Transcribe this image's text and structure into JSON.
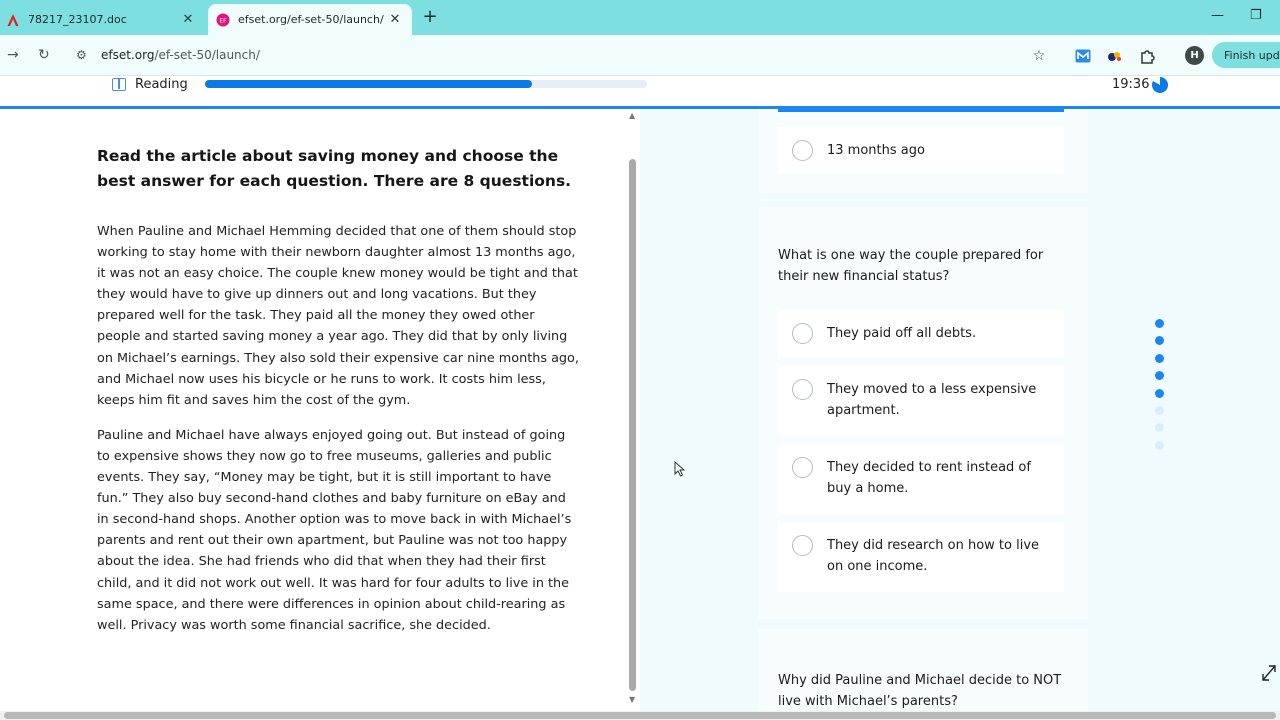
{
  "browser": {
    "tabs": [
      {
        "label": "78217_23107.doc",
        "icon": "acrobat-icon",
        "active": false
      },
      {
        "label": "efset.org/ef-set-50/launch/",
        "icon": "efset-favicon",
        "active": true
      }
    ],
    "url_host": "efset.org",
    "url_path": "/ef-set-50/launch/",
    "profile_initial": "H",
    "update_button": "Finish update",
    "colors": {
      "tabbar": "#7ddfe0",
      "toolbar": "#f1fcfc"
    }
  },
  "test_header": {
    "section": "Reading",
    "progress_fraction": 0.74,
    "timer": "19:36",
    "accent": "#0a7ae6"
  },
  "reading": {
    "instructions": "Read the article about saving money and choose the best answer for each question. There are 8 questions.",
    "paragraphs": [
      "When Pauline and Michael Hemming decided that one of them should stop working to stay home with their newborn daughter almost 13 months ago, it was not an easy choice. The couple knew money would be tight and that they would have to give up dinners out and long vacations. But they prepared well for the task. They paid all the money they owed other people and started saving money a year ago. They did that by only living on Michael’s earnings. They also sold their expensive car nine months ago, and Michael now uses his bicycle or he runs to work. It costs him less, keeps him fit and saves him the cost of the gym.",
      "Pauline and Michael have always enjoyed going out. But instead of going to expensive shows they now go to free museums, galleries and public events. They say, “Money may be tight, but it is still important to have fun.” They also buy second-hand clothes and baby furniture on eBay and in second-hand shops. Another option was to move back in with Michael’s parents and rent out their own apartment, but Pauline was not too happy about the idea. She had friends who did that when they had their first child, and it did not work out well. It was hard for four adults to live in the same space, and there were differences in opinion about child-rearing as well. Privacy was worth some financial sacrifice, she decided."
    ]
  },
  "questions": {
    "previous_option": "13 months ago",
    "current": {
      "question": "What is one way the couple prepared for their new financial status?",
      "options": [
        "They paid off all debts.",
        "They moved to a less expensive apartment.",
        "They decided to rent instead of buy a home.",
        "They did research on how to live on one income."
      ]
    },
    "next_question": "Why did Pauline and Michael decide to NOT live with Michael’s parents?",
    "progress_dots": {
      "total": 8,
      "completed": 5,
      "done_color": "#1a86f0",
      "todo_color": "#d9eefc"
    }
  }
}
